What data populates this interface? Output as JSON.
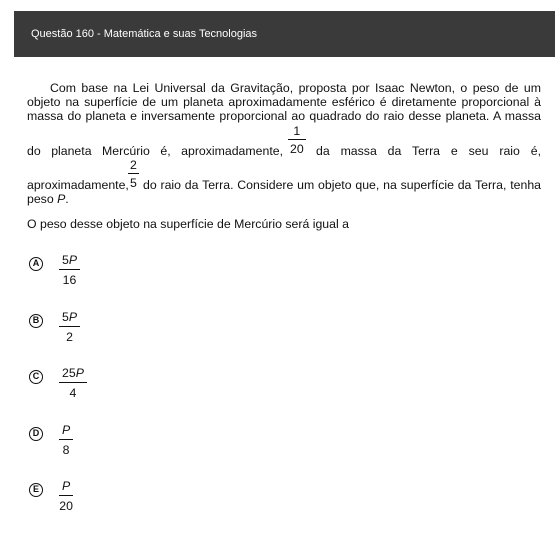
{
  "header": {
    "title": "Questão 160 - Matemática e suas Tecnologias"
  },
  "question": {
    "line1": "Com base na Lei Universal da Gravitação, proposta por Isaac Newton, o peso de um",
    "line2": "objeto na superfície de um planeta aproximadamente esférico é diretamente proporcional à",
    "line3": "massa do planeta e inversamente proporcional ao quadrado do raio desse planeta. A massa",
    "line4_a": "do planeta Mercúrio é, aproximadamente,",
    "frac1_num": "1",
    "frac1_den": "20",
    "line4_b": "da massa da Terra e seu raio é,",
    "line5_a": "aproximadamente,",
    "frac2_num": "2",
    "frac2_den": "5",
    "line5_b": "do raio da Terra. Considere um objeto que, na superfície da Terra, tenha",
    "line6_a": "peso",
    "line6_var": "P",
    "line6_b": ".",
    "prompt": "O peso desse objeto na superfície de Mercúrio será igual a"
  },
  "options": [
    {
      "letter": "A",
      "num": "5P",
      "den": "16"
    },
    {
      "letter": "B",
      "num": "5P",
      "den": "2"
    },
    {
      "letter": "C",
      "num": "25P",
      "den": "4"
    },
    {
      "letter": "D",
      "num": "P",
      "den": "8"
    },
    {
      "letter": "E",
      "num": "P",
      "den": "20"
    }
  ]
}
